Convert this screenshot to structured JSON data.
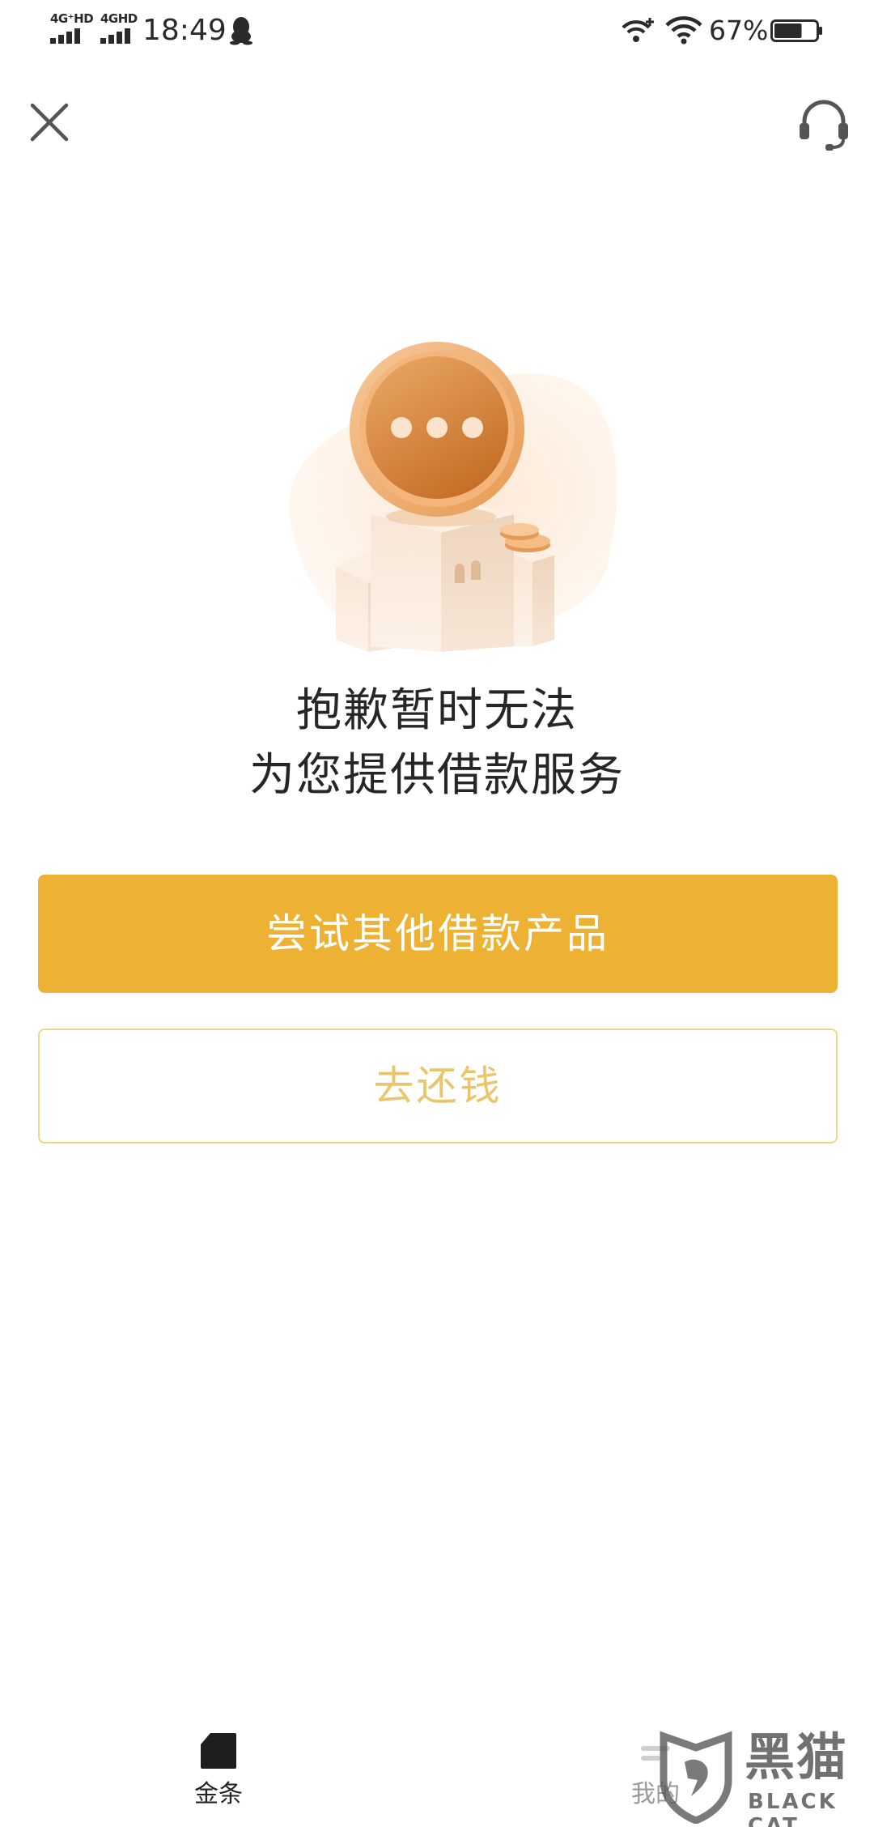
{
  "status_bar": {
    "sim1_network": "4G⁺HD",
    "sim2_network": "4GHD",
    "time": "18:49",
    "battery_percent": "67%",
    "battery_level": 0.67,
    "icons": [
      "signal-icon",
      "signal-icon",
      "qq-icon",
      "wifi-calling-icon",
      "wifi-icon",
      "battery-icon"
    ]
  },
  "header": {
    "close_icon": "close-icon",
    "support_icon": "headset-icon"
  },
  "illustration": {
    "icon": "coin-building-illustration"
  },
  "message": {
    "line1": "抱歉暂时无法",
    "line2": "为您提供借款服务"
  },
  "actions": {
    "primary_label": "尝试其他借款产品",
    "secondary_label": "去还钱"
  },
  "tabbar": {
    "items": [
      {
        "label": "金条",
        "icon": "jintiao-icon",
        "active": true
      },
      {
        "label": "我的",
        "icon": "mine-icon",
        "active": false
      }
    ]
  },
  "watermark": {
    "cn": "黑猫",
    "en": "BLACK CAT"
  },
  "colors": {
    "primary": "#edb233",
    "secondary_border": "#f1d689",
    "secondary_text": "#e9c56b",
    "coin": "#d98a3e"
  }
}
